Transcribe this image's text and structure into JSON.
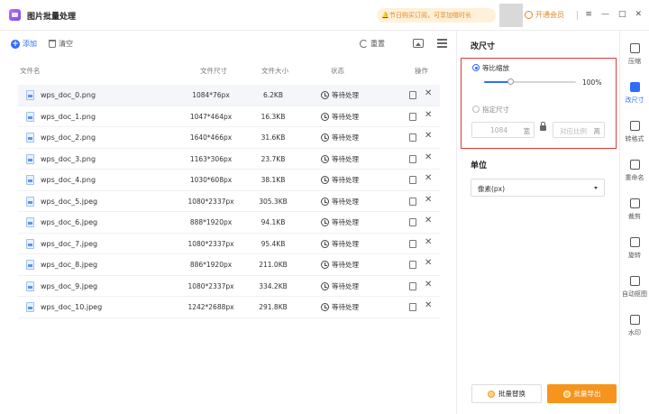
{
  "app": {
    "title": "图片批量处理",
    "notice": "节日购买订阅，可享加赠时长",
    "vip_label": "开通会员"
  },
  "window_controls": {
    "menu": "≡",
    "minimize": "—",
    "maximize": "□",
    "close": "✕"
  },
  "toolbar": {
    "add_label": "添加",
    "clear_label": "清空",
    "reset_label": "重置"
  },
  "table": {
    "headers": {
      "name": "文件名",
      "dimensions": "文件尺寸",
      "size": "文件大小",
      "status": "状态",
      "actions": "操作"
    },
    "rows": [
      {
        "name": "wps_doc_0.png",
        "dimensions": "1084*76px",
        "size": "6.2KB",
        "status": "等待处理"
      },
      {
        "name": "wps_doc_1.png",
        "dimensions": "1047*464px",
        "size": "16.3KB",
        "status": "等待处理"
      },
      {
        "name": "wps_doc_2.png",
        "dimensions": "1640*466px",
        "size": "31.6KB",
        "status": "等待处理"
      },
      {
        "name": "wps_doc_3.png",
        "dimensions": "1163*306px",
        "size": "23.7KB",
        "status": "等待处理"
      },
      {
        "name": "wps_doc_4.png",
        "dimensions": "1030*608px",
        "size": "38.1KB",
        "status": "等待处理"
      },
      {
        "name": "wps_doc_5.jpeg",
        "dimensions": "1080*2337px",
        "size": "305.3KB",
        "status": "等待处理"
      },
      {
        "name": "wps_doc_6.jpeg",
        "dimensions": "888*1920px",
        "size": "94.1KB",
        "status": "等待处理"
      },
      {
        "name": "wps_doc_7.jpeg",
        "dimensions": "1080*2337px",
        "size": "95.4KB",
        "status": "等待处理"
      },
      {
        "name": "wps_doc_8.jpeg",
        "dimensions": "886*1920px",
        "size": "211.0KB",
        "status": "等待处理"
      },
      {
        "name": "wps_doc_9.jpeg",
        "dimensions": "1080*2337px",
        "size": "334.2KB",
        "status": "等待处理"
      },
      {
        "name": "wps_doc_10.jpeg",
        "dimensions": "1242*2688px",
        "size": "291.8KB",
        "status": "等待处理"
      }
    ]
  },
  "resize_panel": {
    "title": "改尺寸",
    "option_proportional": "等比缩放",
    "scale_value": "100%",
    "scale_fraction": 0.28,
    "option_custom": "指定尺寸",
    "width_value": "1084",
    "width_suffix": "宽",
    "height_placeholder": "对应比例",
    "height_suffix": "高",
    "unit_title": "单位",
    "unit_value": "像素(px)"
  },
  "actions": {
    "replace_label": "批量替换",
    "export_label": "批量导出"
  },
  "rail": [
    {
      "label": "压缩",
      "icon": "compress-icon",
      "active": false
    },
    {
      "label": "改尺寸",
      "icon": "resize-icon",
      "active": true
    },
    {
      "label": "转格式",
      "icon": "convert-icon",
      "active": false
    },
    {
      "label": "重命名",
      "icon": "rename-icon",
      "active": false
    },
    {
      "label": "裁剪",
      "icon": "crop-icon",
      "active": false
    },
    {
      "label": "旋转",
      "icon": "rotate-icon",
      "active": false
    },
    {
      "label": "自动抠图",
      "icon": "cutout-icon",
      "active": false
    },
    {
      "label": "水印",
      "icon": "watermark-icon",
      "active": false
    }
  ],
  "colors": {
    "accent": "#2f6bff",
    "export": "#f7941d",
    "highlight": "#e03a3a",
    "vip": "#e2892a"
  }
}
